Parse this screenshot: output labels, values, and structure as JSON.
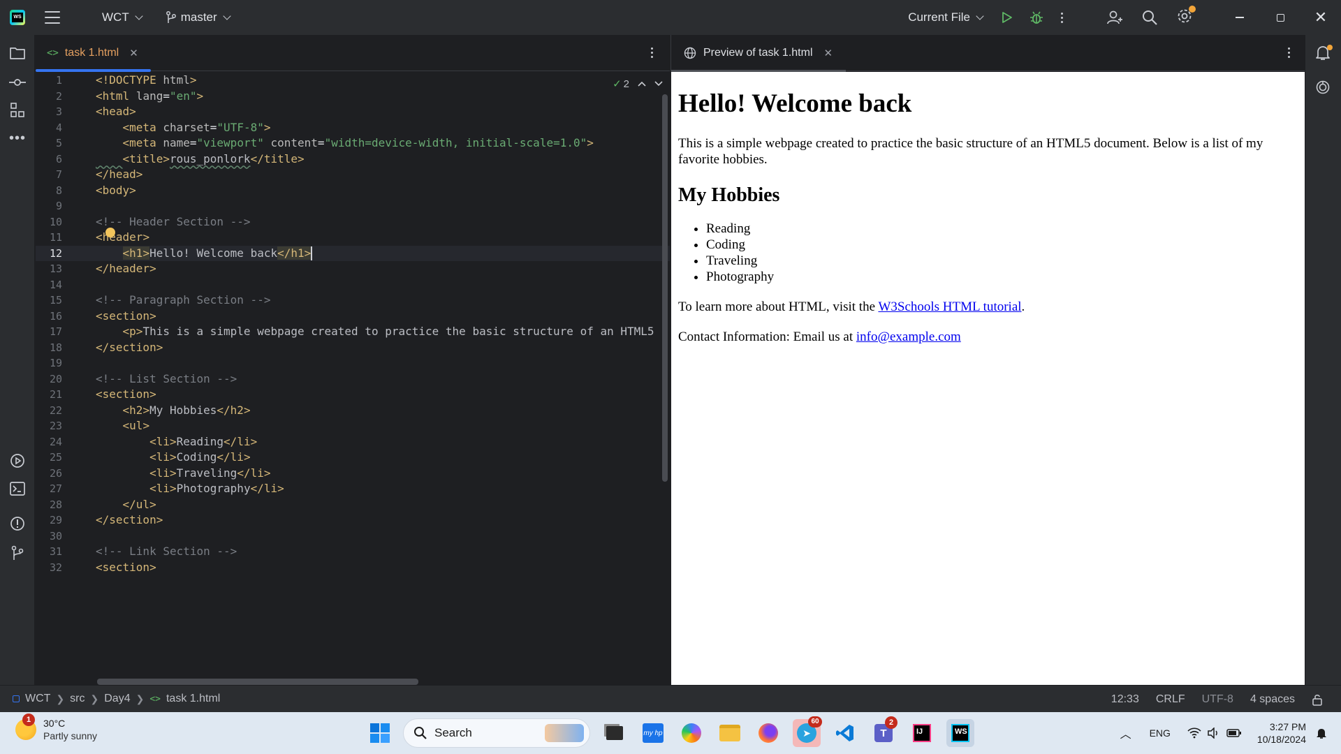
{
  "titlebar": {
    "project": "WCT",
    "branch": "master",
    "run_config": "Current File"
  },
  "editor": {
    "tab_label": "task 1.html",
    "inspection_count": "2",
    "lines": [
      "<!DOCTYPE html>",
      "<html lang=\"en\">",
      "<head>",
      "    <meta charset=\"UTF-8\">",
      "    <meta name=\"viewport\" content=\"width=device-width, initial-scale=1.0\">",
      "    <title>rous_ponlork</title>",
      "</head>",
      "<body>",
      "",
      "<!-- Header Section -->",
      "<header>",
      "    <h1>Hello! Welcome back</h1>",
      "</header>",
      "",
      "<!-- Paragraph Section -->",
      "<section>",
      "    <p>This is a simple webpage created to practice the basic structure of an HTML5",
      "</section>",
      "",
      "<!-- List Section -->",
      "<section>",
      "    <h2>My Hobbies</h2>",
      "    <ul>",
      "        <li>Reading</li>",
      "        <li>Coding</li>",
      "        <li>Traveling</li>",
      "        <li>Photography</li>",
      "    </ul>",
      "</section>",
      "",
      "<!-- Link Section -->",
      "<section>"
    ],
    "current_line": 12
  },
  "preview": {
    "tab_label": "Preview of task 1.html",
    "h1": "Hello! Welcome back",
    "intro": "This is a simple webpage created to practice the basic structure of an HTML5 document. Below is a list of my favorite hobbies.",
    "h2": "My Hobbies",
    "hobbies": [
      "Reading",
      "Coding",
      "Traveling",
      "Photography"
    ],
    "learn_prefix": "To learn more about HTML, visit the ",
    "learn_link": "W3Schools HTML tutorial",
    "learn_suffix": ".",
    "contact_prefix": "Contact Information: Email us at ",
    "contact_link": "info@example.com"
  },
  "statusbar": {
    "crumbs": [
      "WCT",
      "src",
      "Day4",
      "task 1.html"
    ],
    "position": "12:33",
    "line_sep": "CRLF",
    "encoding": "UTF-8",
    "indent": "4 spaces"
  },
  "taskbar": {
    "weather_temp": "30°C",
    "weather_desc": "Partly sunny",
    "weather_badge": "1",
    "search_placeholder": "Search",
    "telegram_badge": "60",
    "teams_badge": "2",
    "lang": "ENG",
    "time": "3:27 PM",
    "date": "10/18/2024"
  },
  "colors": {
    "accent": "#3574f0",
    "tag": "#d5b778",
    "string": "#6aab73",
    "comment": "#7a7e85",
    "link": "#0000ee"
  }
}
